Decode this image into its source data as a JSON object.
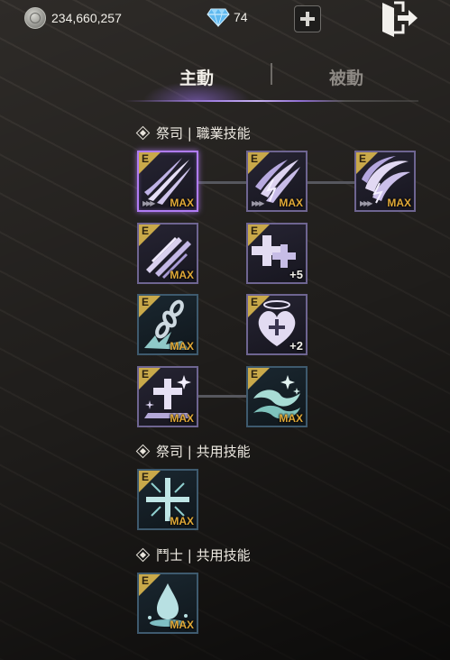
{
  "currency": {
    "silver_amount": "234,660,257",
    "diamond_amount": "74",
    "coin_icon": "silver-coin-icon",
    "gem_icon": "diamond-icon"
  },
  "tabs": [
    {
      "label": "主動",
      "active": true
    },
    {
      "label": "被動",
      "active": false
    }
  ],
  "sections": {
    "class_skills": "祭司 | 職業技能",
    "shared_priest": "祭司 | 共用技能",
    "shared_warrior": "鬥士 | 共用技能"
  },
  "skills": {
    "corner_label": "E",
    "s1": {
      "level": "MAX",
      "icon": "triple-claw-strike-icon"
    },
    "s2": {
      "level": "MAX",
      "icon": "lightning-claw-icon"
    },
    "s3": {
      "level": "MAX",
      "icon": "storm-claw-icon"
    },
    "s4": {
      "level": "MAX",
      "icon": "multi-slash-icon"
    },
    "s5": {
      "level": "+5",
      "icon": "double-cross-icon"
    },
    "s6": {
      "level": "MAX",
      "icon": "chain-icon"
    },
    "s7": {
      "level": "+2",
      "icon": "holy-heart-icon"
    },
    "s8": {
      "level": "MAX",
      "icon": "sparkle-cross-icon"
    },
    "s9": {
      "level": "MAX",
      "icon": "wave-icon"
    },
    "s10": {
      "level": "MAX",
      "icon": "radiant-cross-icon"
    },
    "s11": {
      "level": "MAX",
      "icon": "water-drop-icon"
    }
  },
  "colors": {
    "accent_purple": "#b07cf5",
    "max_gold": "#e0a938",
    "corner_gold": "#c9a94a"
  }
}
